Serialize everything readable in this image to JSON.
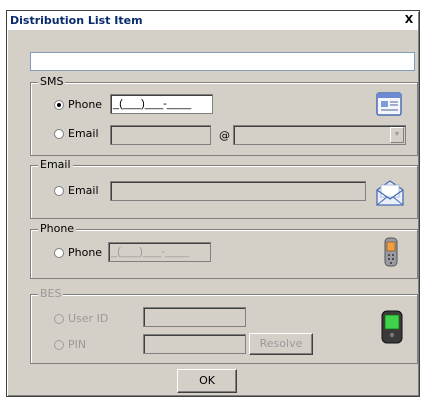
{
  "dialog": {
    "title": "Distribution List Item",
    "close_label": "X"
  },
  "name_input": {
    "value": ""
  },
  "sms": {
    "legend": "SMS",
    "phone_label": "Phone",
    "phone_value": "_(___)___-____",
    "email_label": "Email",
    "email_user_value": "",
    "at_sign": "@",
    "email_domain_value": "",
    "icon": "contact-card-icon"
  },
  "email": {
    "legend": "Email",
    "email_label": "Email",
    "email_value": "",
    "icon": "envelope-icon"
  },
  "phone": {
    "legend": "Phone",
    "phone_label": "Phone",
    "phone_value": "_(___)___-____",
    "icon": "mobile-phone-icon"
  },
  "bes": {
    "legend": "BES",
    "userid_label": "User ID",
    "userid_value": "",
    "pin_label": "PIN",
    "pin_value": "",
    "resolve_label": "Resolve",
    "icon": "blackberry-device-icon"
  },
  "footer": {
    "ok_label": "OK"
  }
}
